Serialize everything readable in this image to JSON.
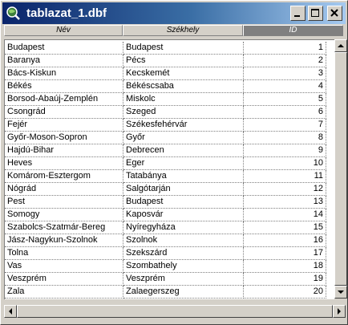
{
  "window": {
    "title": "tablazat_1.dbf"
  },
  "table": {
    "columns": [
      "Név",
      "Székhely",
      "ID"
    ],
    "active_column": 2,
    "rows": [
      [
        "Budapest",
        "Budapest",
        "1"
      ],
      [
        "Baranya",
        "Pécs",
        "2"
      ],
      [
        "Bács-Kiskun",
        "Kecskemét",
        "3"
      ],
      [
        "Békés",
        "Békéscsaba",
        "4"
      ],
      [
        "Borsod-Abaúj-Zemplén",
        "Miskolc",
        "5"
      ],
      [
        "Csongrád",
        "Szeged",
        "6"
      ],
      [
        "Fejér",
        "Székesfehérvár",
        "7"
      ],
      [
        "Győr-Moson-Sopron",
        "Győr",
        "8"
      ],
      [
        "Hajdú-Bihar",
        "Debrecen",
        "9"
      ],
      [
        "Heves",
        "Eger",
        "10"
      ],
      [
        "Komárom-Esztergom",
        "Tatabánya",
        "11"
      ],
      [
        "Nógrád",
        "Salgótarján",
        "12"
      ],
      [
        "Pest",
        "Budapest",
        "13"
      ],
      [
        "Somogy",
        "Kaposvár",
        "14"
      ],
      [
        "Szabolcs-Szatmár-Bereg",
        "Nyíregyháza",
        "15"
      ],
      [
        "Jász-Nagykun-Szolnok",
        "Szolnok",
        "16"
      ],
      [
        "Tolna",
        "Szekszárd",
        "17"
      ],
      [
        "Vas",
        "Szombathely",
        "18"
      ],
      [
        "Veszprém",
        "Veszprém",
        "19"
      ],
      [
        "Zala",
        "Zalaegerszeg",
        "20"
      ]
    ]
  },
  "icons": {
    "app": "globe-magnifier-icon",
    "minimize": "minimize-icon",
    "maximize": "maximize-icon",
    "close": "close-icon"
  }
}
